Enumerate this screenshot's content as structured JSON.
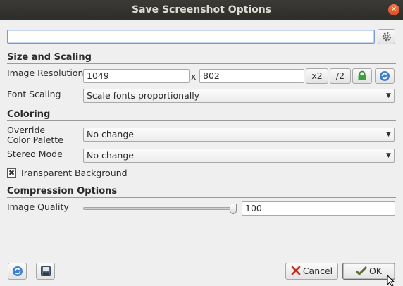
{
  "window": {
    "title": "Save Screenshot Options"
  },
  "filename": {
    "value": ""
  },
  "size_section": {
    "title": "Size and Scaling",
    "resolution_label": "Image Resolution",
    "width": "1049",
    "times": "x",
    "height": "802",
    "double_label": "x2",
    "half_label": "/2",
    "font_scaling_label": "Font Scaling",
    "font_scaling_value": "Scale fonts proportionally"
  },
  "coloring_section": {
    "title": "Coloring",
    "palette_label_line1": "Override",
    "palette_label_line2": "Color Palette",
    "palette_value": "No change",
    "stereo_label": "Stereo Mode",
    "stereo_value": "No change",
    "transparent_label": "Transparent Background",
    "transparent_checked": true
  },
  "compression_section": {
    "title": "Compression Options",
    "quality_label": "Image Quality",
    "quality_value": "100",
    "quality_fraction": 1.0
  },
  "buttons": {
    "cancel_label": "Cancel",
    "ok_label": "OK"
  },
  "colors": {
    "titlebar": "#2e2d2a",
    "close": "#e0572e",
    "lock_green": "#3aa33a",
    "refresh_blue": "#3f7fcf"
  }
}
